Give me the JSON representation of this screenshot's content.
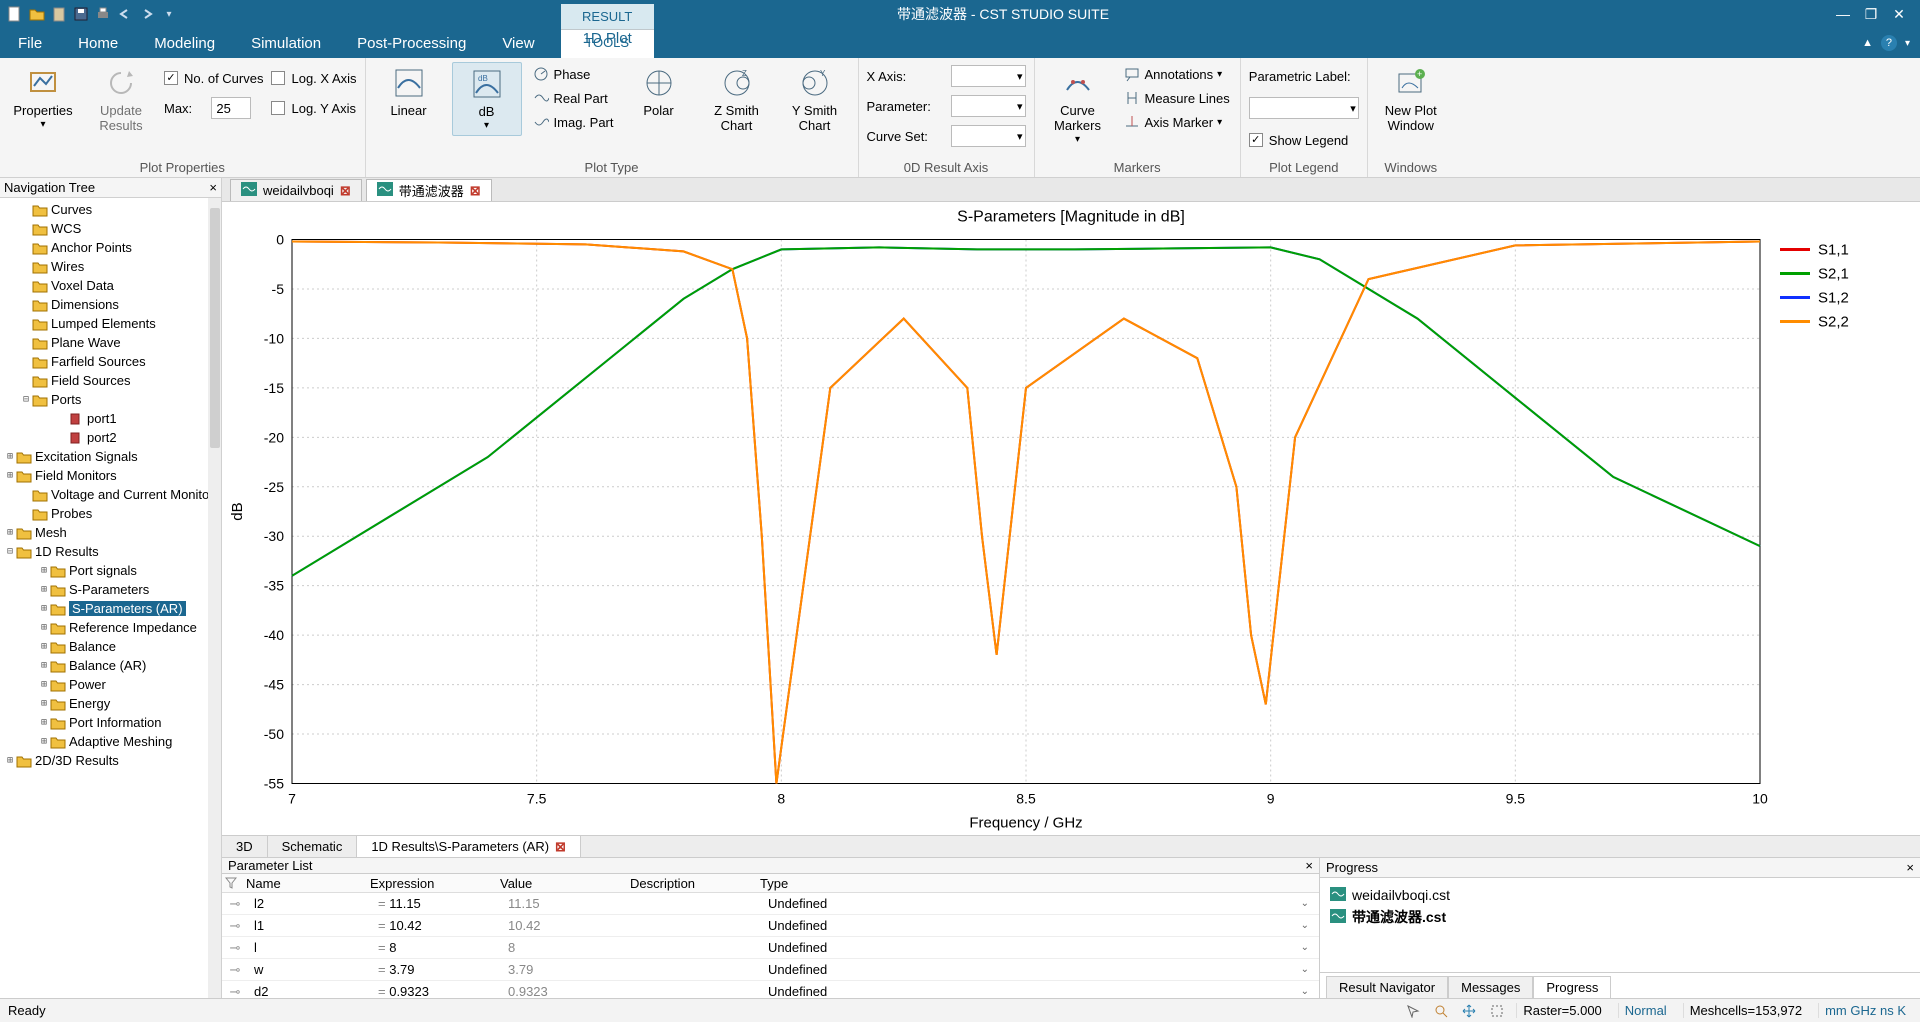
{
  "window": {
    "title": "带通滤波器 - CST STUDIO SUITE",
    "result_tools": "RESULT TOOLS"
  },
  "menus": [
    "File",
    "Home",
    "Modeling",
    "Simulation",
    "Post-Processing",
    "View"
  ],
  "ribbon_tab": "1D Plot",
  "ribbon": {
    "properties": {
      "btn_properties": "Properties",
      "btn_update": "Update\nResults",
      "group": "Plot Properties",
      "num_curves": "No. of Curves",
      "max": "Max:",
      "max_val": "25",
      "logx": "Log. X Axis",
      "logy": "Log. Y Axis"
    },
    "plottype": {
      "linear": "Linear",
      "db": "dB",
      "phase": "Phase",
      "real": "Real Part",
      "imag": "Imag. Part",
      "group": "Plot Type",
      "polar": "Polar",
      "zsmith": "Z Smith\nChart",
      "ysmith": "Y Smith\nChart"
    },
    "axis0d": {
      "xaxis": "X Axis:",
      "param": "Parameter:",
      "curveset": "Curve Set:",
      "group": "0D Result Axis"
    },
    "markers": {
      "curve": "Curve\nMarkers",
      "ann": "Annotations",
      "meas": "Measure Lines",
      "axism": "Axis Marker",
      "group": "Markers"
    },
    "legend": {
      "plabel": "Parametric Label:",
      "show": "Show Legend",
      "group": "Plot Legend"
    },
    "windows": {
      "newplot": "New Plot\nWindow",
      "group": "Windows"
    }
  },
  "nav_header": "Navigation Tree",
  "nav_tree": [
    {
      "t": "Curves",
      "i": 1
    },
    {
      "t": "WCS",
      "i": 1
    },
    {
      "t": "Anchor Points",
      "i": 1
    },
    {
      "t": "Wires",
      "i": 1
    },
    {
      "t": "Voxel Data",
      "i": 1
    },
    {
      "t": "Dimensions",
      "i": 1
    },
    {
      "t": "Lumped Elements",
      "i": 1
    },
    {
      "t": "Plane Wave",
      "i": 1
    },
    {
      "t": "Farfield Sources",
      "i": 1
    },
    {
      "t": "Field Sources",
      "i": 1
    },
    {
      "t": "Ports",
      "i": 1,
      "exp": "-"
    },
    {
      "t": "port1",
      "i": 3,
      "port": true
    },
    {
      "t": "port2",
      "i": 3,
      "port": true
    },
    {
      "t": "Excitation Signals",
      "i": 0,
      "exp": "+"
    },
    {
      "t": "Field Monitors",
      "i": 0,
      "exp": "+"
    },
    {
      "t": "Voltage and Current Monitors",
      "i": 1
    },
    {
      "t": "Probes",
      "i": 1
    },
    {
      "t": "Mesh",
      "i": 0,
      "exp": "+"
    },
    {
      "t": "1D Results",
      "i": 0,
      "exp": "-"
    },
    {
      "t": "Port signals",
      "i": 2,
      "exp": "+"
    },
    {
      "t": "S-Parameters",
      "i": 2,
      "exp": "+"
    },
    {
      "t": "S-Parameters (AR)",
      "i": 2,
      "exp": "+",
      "sel": true
    },
    {
      "t": "Reference Impedance",
      "i": 2,
      "exp": "+"
    },
    {
      "t": "Balance",
      "i": 2,
      "exp": "+"
    },
    {
      "t": "Balance (AR)",
      "i": 2,
      "exp": "+"
    },
    {
      "t": "Power",
      "i": 2,
      "exp": "+"
    },
    {
      "t": "Energy",
      "i": 2,
      "exp": "+"
    },
    {
      "t": "Port Information",
      "i": 2,
      "exp": "+"
    },
    {
      "t": "Adaptive Meshing",
      "i": 2,
      "exp": "+"
    },
    {
      "t": "2D/3D Results",
      "i": 0,
      "exp": "+"
    }
  ],
  "doc_tabs": [
    {
      "label": "weidailvboqi",
      "active": false,
      "close": true
    },
    {
      "label": "带通滤波器",
      "active": true,
      "close": true
    }
  ],
  "lower_tabs": [
    {
      "label": "3D"
    },
    {
      "label": "Schematic"
    },
    {
      "label": "1D Results\\S-Parameters (AR)",
      "active": true,
      "close": true
    }
  ],
  "param_panel": {
    "title": "Parameter List",
    "headers": [
      "Name",
      "Expression",
      "Value",
      "Description",
      "Type"
    ],
    "rows": [
      {
        "name": "l2",
        "expr": "11.15",
        "val": "11.15",
        "type": "Undefined"
      },
      {
        "name": "l1",
        "expr": "10.42",
        "val": "10.42",
        "type": "Undefined"
      },
      {
        "name": "l",
        "expr": "8",
        "val": "8",
        "type": "Undefined"
      },
      {
        "name": "w",
        "expr": "3.79",
        "val": "3.79",
        "type": "Undefined"
      },
      {
        "name": "d2",
        "expr": "0.9323",
        "val": "0.9323",
        "type": "Undefined"
      }
    ]
  },
  "progress_panel": {
    "title": "Progress",
    "files": [
      {
        "name": "weidailvboqi.cst",
        "bold": false
      },
      {
        "name": "带通滤波器.cst",
        "bold": true
      }
    ],
    "tabs": [
      {
        "label": "Result Navigator"
      },
      {
        "label": "Messages"
      },
      {
        "label": "Progress",
        "active": true
      }
    ]
  },
  "status": {
    "ready": "Ready",
    "raster": "Raster=5.000",
    "normal": "Normal",
    "mesh": "Meshcells=153,972",
    "units": "mm  GHz  ns  K"
  },
  "chart_data": {
    "type": "line",
    "title": "S-Parameters [Magnitude in dB]",
    "xlabel": "Frequency / GHz",
    "ylabel": "dB",
    "xlim": [
      7,
      10
    ],
    "ylim": [
      -55,
      0
    ],
    "xticks": [
      7,
      7.5,
      8,
      8.5,
      9,
      9.5,
      10
    ],
    "yticks": [
      0,
      -5,
      -10,
      -15,
      -20,
      -25,
      -30,
      -35,
      -40,
      -45,
      -50,
      -55
    ],
    "legend": [
      "S1,1",
      "S2,1",
      "S1,2",
      "S2,2"
    ],
    "colors": {
      "S1,1": "#e40000",
      "S2,1": "#00a000",
      "S1,2": "#1030ff",
      "S2,2": "#ff8c00"
    },
    "series": [
      {
        "name": "S1,2",
        "x": [
          7,
          7.2,
          7.4,
          7.6,
          7.8,
          7.9,
          8.0,
          8.2,
          8.4,
          8.6,
          8.8,
          9.0,
          9.1,
          9.3,
          9.5,
          9.7,
          10
        ],
        "y": [
          -34,
          -28,
          -22,
          -14,
          -6,
          -3,
          -1,
          -0.8,
          -1,
          -1,
          -0.9,
          -0.8,
          -2,
          -8,
          -16,
          -24,
          -31
        ]
      },
      {
        "name": "S2,1",
        "x": [
          7,
          7.2,
          7.4,
          7.6,
          7.8,
          7.9,
          8.0,
          8.2,
          8.4,
          8.6,
          8.8,
          9.0,
          9.1,
          9.3,
          9.5,
          9.7,
          10
        ],
        "y": [
          -34,
          -28,
          -22,
          -14,
          -6,
          -3,
          -1,
          -0.8,
          -1,
          -1,
          -0.9,
          -0.8,
          -2,
          -8,
          -16,
          -24,
          -31
        ]
      },
      {
        "name": "S1,1",
        "x": [
          7,
          7.3,
          7.6,
          7.8,
          7.9,
          7.93,
          7.96,
          7.99,
          8.1,
          8.25,
          8.38,
          8.41,
          8.44,
          8.5,
          8.7,
          8.85,
          8.93,
          8.96,
          8.99,
          9.05,
          9.2,
          9.5,
          10
        ],
        "y": [
          -0.2,
          -0.3,
          -0.5,
          -1.2,
          -3,
          -10,
          -30,
          -55,
          -15,
          -8,
          -15,
          -30,
          -42,
          -15,
          -8,
          -12,
          -25,
          -40,
          -47,
          -20,
          -4,
          -0.6,
          -0.2
        ]
      },
      {
        "name": "S2,2",
        "x": [
          7,
          7.3,
          7.6,
          7.8,
          7.9,
          7.93,
          7.96,
          7.99,
          8.1,
          8.25,
          8.38,
          8.41,
          8.44,
          8.5,
          8.7,
          8.85,
          8.93,
          8.96,
          8.99,
          9.05,
          9.2,
          9.5,
          10
        ],
        "y": [
          -0.2,
          -0.3,
          -0.5,
          -1.2,
          -3,
          -10,
          -30,
          -55,
          -15,
          -8,
          -15,
          -30,
          -42,
          -15,
          -8,
          -12,
          -25,
          -40,
          -47,
          -20,
          -4,
          -0.6,
          -0.2
        ]
      }
    ]
  }
}
